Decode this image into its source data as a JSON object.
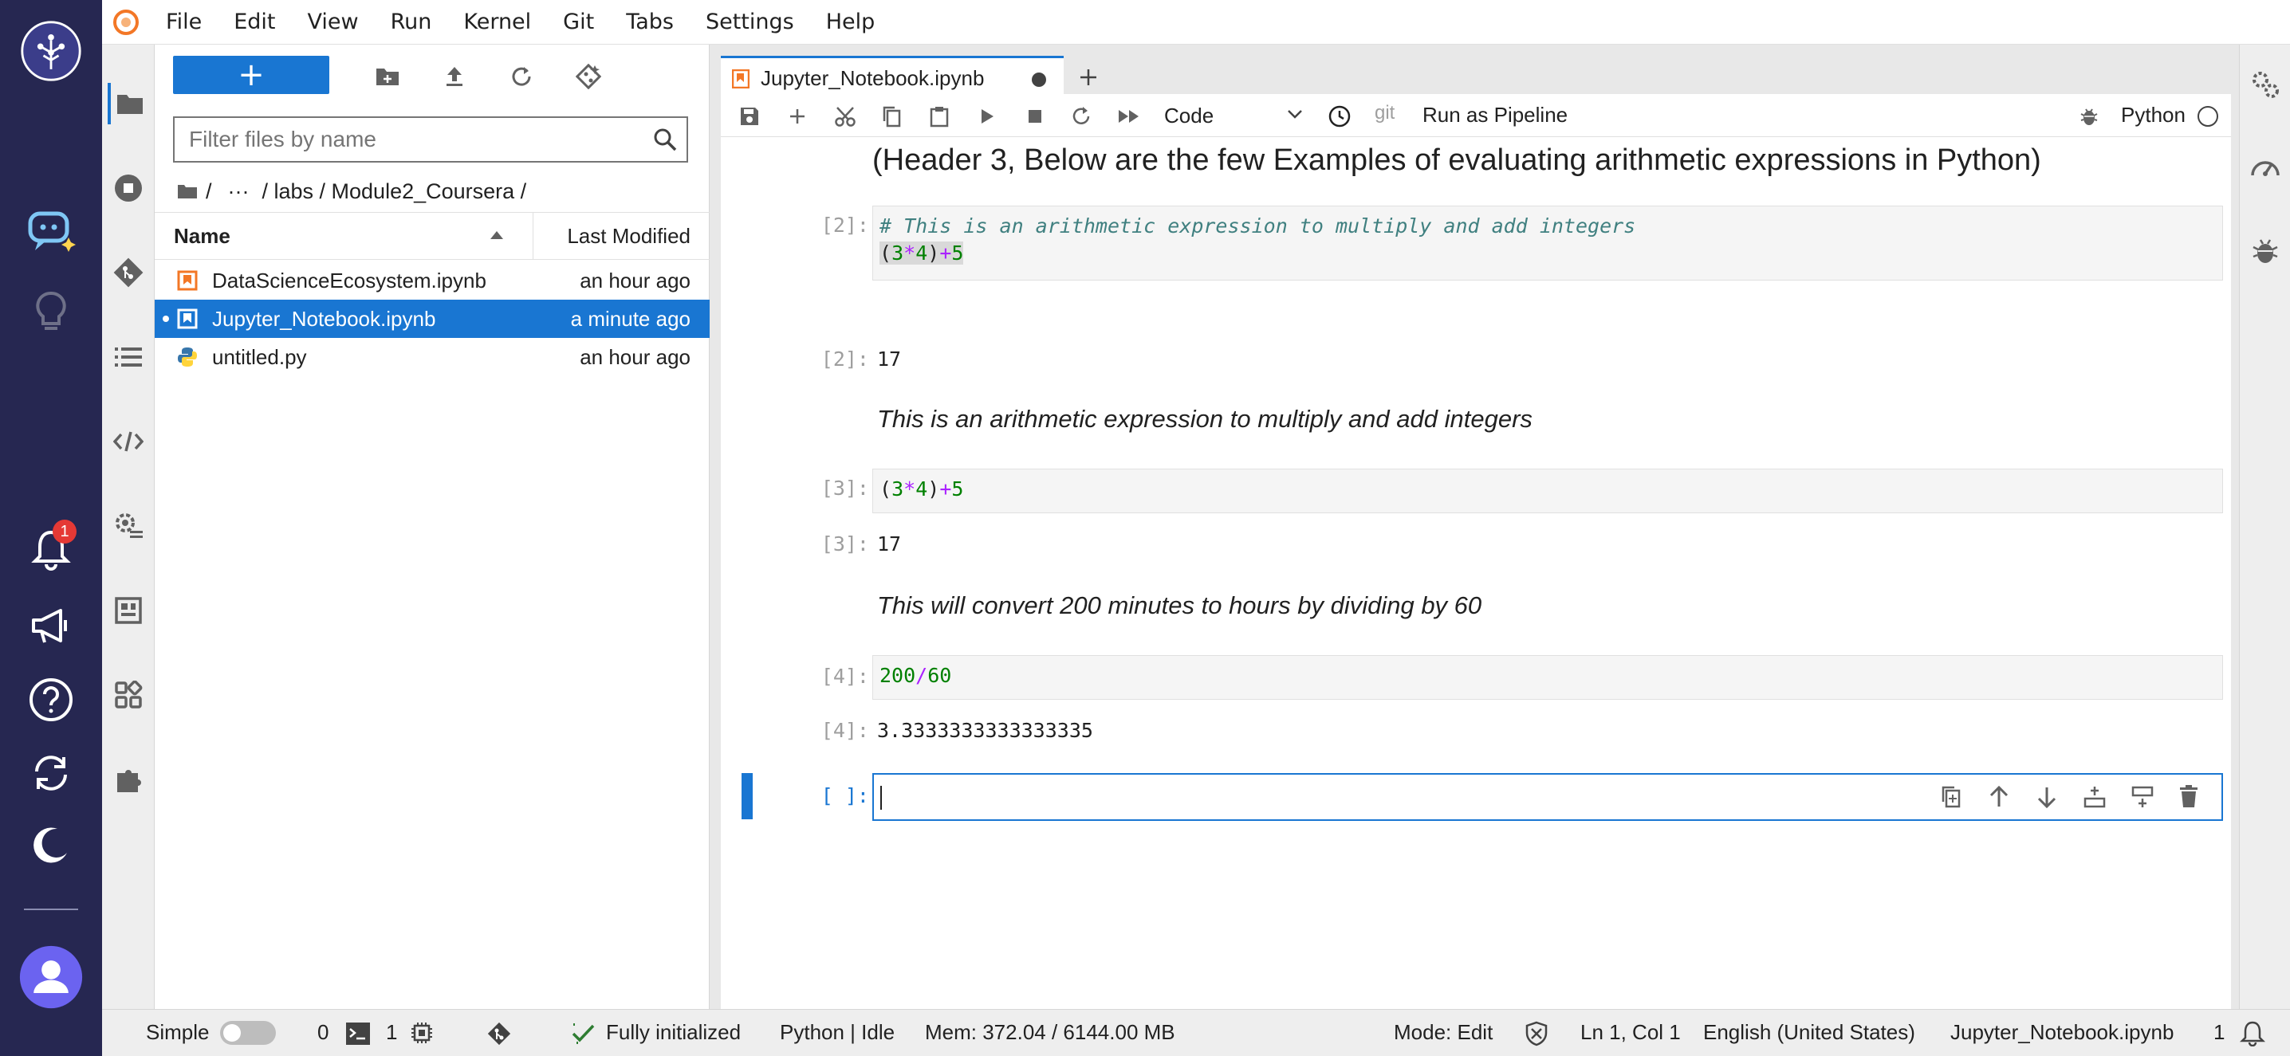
{
  "menubar": {
    "items": [
      "File",
      "Edit",
      "View",
      "Run",
      "Kernel",
      "Git",
      "Tabs",
      "Settings",
      "Help"
    ]
  },
  "rail": {
    "notification_count": "1"
  },
  "filebrowser": {
    "new_label": "+",
    "filter_placeholder": "Filter files by name",
    "breadcrumbs": [
      "/",
      "···",
      "/ labs / Module2_Coursera /"
    ],
    "columns": {
      "name": "Name",
      "modified": "Last Modified"
    },
    "files": [
      {
        "name": "DataScienceEcosystem.ipynb",
        "modified": "an hour ago",
        "type": "notebook"
      },
      {
        "name": "Jupyter_Notebook.ipynb",
        "modified": "a minute ago",
        "type": "notebook"
      },
      {
        "name": "untitled.py",
        "modified": "an hour ago",
        "type": "python"
      }
    ]
  },
  "notebook": {
    "tab_title": "Jupyter_Notebook.ipynb",
    "cell_type": "Code",
    "git_label": "git",
    "pipeline_label": "Run as Pipeline",
    "kernel_name": "Python",
    "header_text": "(Header 3, Below are the few Examples of evaluating arithmetic expressions in Python)",
    "cells": {
      "c1_prompt": "[2]:",
      "c1_comment": "# This is an arithmetic expression to multiply and add integers",
      "c1_out_prompt": "[2]:",
      "c1_out": "17",
      "md1": "This is an arithmetic expression to multiply and add integers",
      "c2_prompt": "[3]:",
      "c2_out_prompt": "[3]:",
      "c2_out": "17",
      "md2": "This will convert 200 minutes to hours by dividing by 60",
      "c3_prompt": "[4]:",
      "c3_out_prompt": "[4]:",
      "c3_out": "3.3333333333333335",
      "c4_prompt": "[ ]:"
    },
    "code_tokens": {
      "lp": "(",
      "three": "3",
      "star": "*",
      "four": "4",
      "rp": ")",
      "plus": "+",
      "five": "5",
      "n200": "200",
      "slash": "/",
      "n60": "60"
    }
  },
  "statusbar": {
    "mode_label": "Simple",
    "count_a": "0",
    "count_b": "1",
    "init_status": "Fully initialized",
    "kernel_status": "Python | Idle",
    "memory": "Mem: 372.04 / 6144.00 MB",
    "edit_mode": "Mode: Edit",
    "cursor_pos": "Ln 1, Col 1",
    "language": "English (United States)",
    "filename": "Jupyter_Notebook.ipynb",
    "notif_count": "1"
  },
  "colors": {
    "accent": "#1976d2",
    "rail": "#262751",
    "badge": "#e53935"
  }
}
